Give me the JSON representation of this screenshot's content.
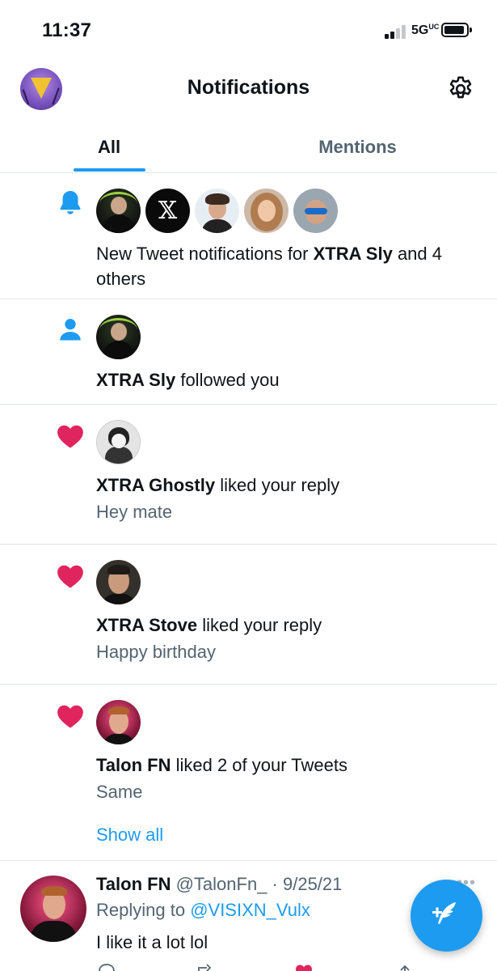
{
  "status_bar": {
    "time": "11:37",
    "network": "5G",
    "network_suffix": "UC"
  },
  "header": {
    "title": "Notifications"
  },
  "tabs": [
    {
      "label": "All",
      "active": true
    },
    {
      "label": "Mentions",
      "active": false
    }
  ],
  "notifications": [
    {
      "type": "bell-icon",
      "actor": "XTRA Sly",
      "text_before": "New Tweet notifications for ",
      "text_after": " and 4 others"
    },
    {
      "type": "person-icon",
      "actor": "XTRA Sly",
      "text_after": " followed you"
    },
    {
      "type": "heart-icon",
      "actor": "XTRA Ghostly",
      "text_after": " liked your reply",
      "snippet": "Hey mate"
    },
    {
      "type": "heart-icon",
      "actor": "XTRA Stove",
      "text_after": " liked your reply",
      "snippet": "Happy birthday"
    },
    {
      "type": "heart-icon",
      "actor": "Talon FN",
      "text_after": " liked 2 of your Tweets",
      "snippet": "Same",
      "link": "Show all"
    }
  ],
  "tweet": {
    "name": "Talon FN",
    "handle": "@TalonFn_",
    "date": " · 9/25/21",
    "replying_prefix": "Replying to ",
    "replying_to": "@VISIXN_Vulx",
    "body": "I like it a lot lol",
    "more": "•••"
  },
  "colors": {
    "accent": "#1d9bf0",
    "like": "#e0245e",
    "secondary_text": "#536471",
    "divider": "#e1e6ea"
  }
}
